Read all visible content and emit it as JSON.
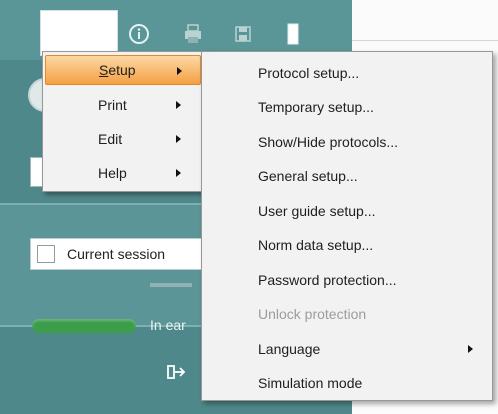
{
  "background": {
    "session_label": "Current session",
    "in_ear_label": "In ear",
    "icons": [
      "info-icon",
      "print-icon",
      "save-icon",
      "document-icon",
      "exit-icon"
    ]
  },
  "menu": {
    "items": [
      {
        "label": "Setup",
        "underline": "S"
      },
      {
        "label": "Print"
      },
      {
        "label": "Edit"
      },
      {
        "label": "Help"
      }
    ]
  },
  "submenu": {
    "items": [
      {
        "label": "Protocol setup..."
      },
      {
        "label": "Temporary setup..."
      },
      {
        "label": "Show/Hide protocols..."
      },
      {
        "label": "General setup..."
      },
      {
        "label": "User guide setup..."
      },
      {
        "label": "Norm data setup..."
      },
      {
        "label": "Password protection..."
      },
      {
        "label": "Unlock protection",
        "disabled": true
      },
      {
        "label": "Language",
        "has_submenu": true
      },
      {
        "label": "Simulation mode"
      }
    ]
  },
  "colors": {
    "app_teal": "#4f888a",
    "menu_highlight": "#f4a043",
    "menu_bg": "#f2f2f2",
    "disabled_text": "#9d9d9d",
    "status_green": "#3c9d4a"
  }
}
